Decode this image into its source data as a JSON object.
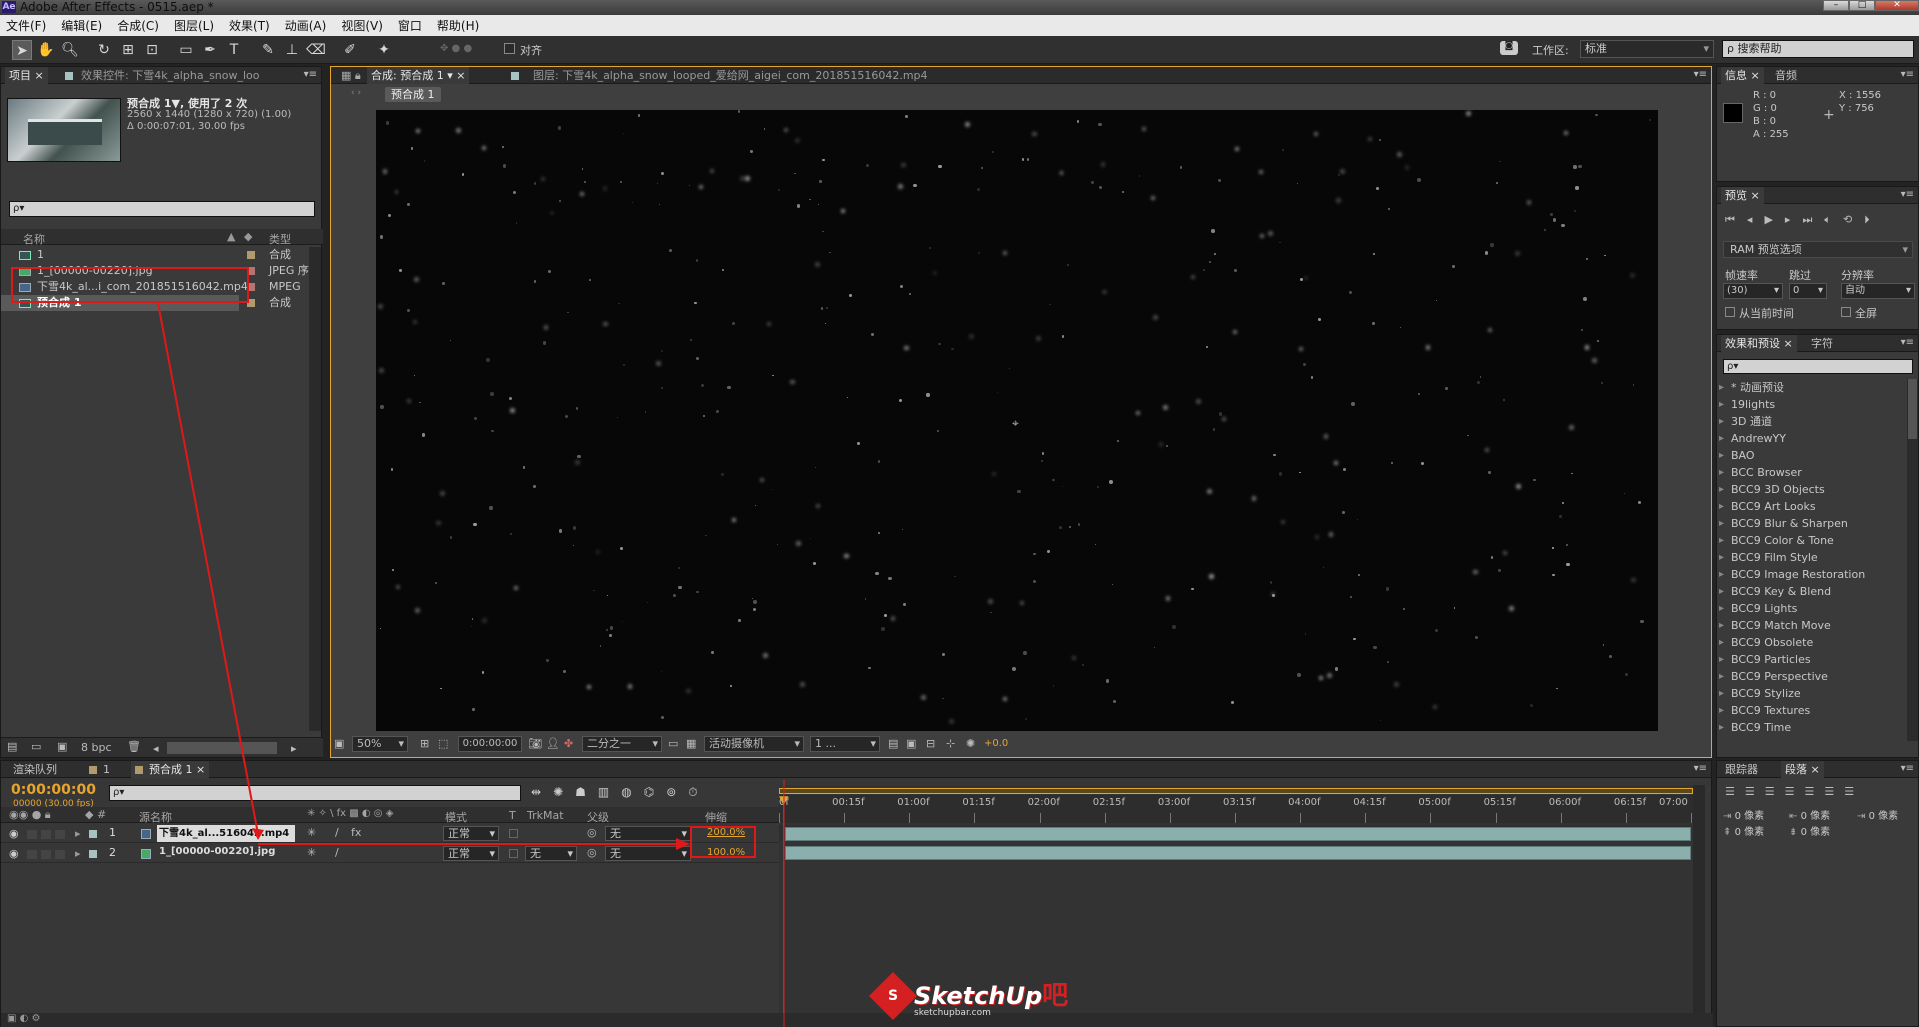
{
  "app": {
    "title": "Adobe After Effects - 0515.aep *",
    "icon_label": "Ae"
  },
  "menu": [
    "文件(F)",
    "编辑(E)",
    "合成(C)",
    "图层(L)",
    "效果(T)",
    "动画(A)",
    "视图(V)",
    "窗口",
    "帮助(H)"
  ],
  "toolbar": {
    "snap_label": "对齐",
    "workspace_label": "工作区:",
    "workspace_value": "标准",
    "search_help_placeholder": "搜索帮助"
  },
  "project_panel": {
    "tab_project": "项目",
    "tab_effect_controls": "效果控件: 下雪4k_alpha_snow_loo",
    "comp_name": "预合成 1▼,  使用了 2 次",
    "comp_size": "2560 x 1440  (1280 x 720) (1.00)",
    "comp_duration": "Δ 0:00:07:01, 30.00 fps",
    "search_placeholder": "ρ▾",
    "col_name": "名称",
    "col_type": "类型",
    "items": [
      {
        "name": "1",
        "type": "合成",
        "kind": "comp",
        "label_color": "#b09a6e"
      },
      {
        "name": "1_[00000-00220].jpg",
        "type": "JPEG 序",
        "kind": "image",
        "label_color": "#b47474"
      },
      {
        "name": "下雪4k_al...i_com_201851516042.mp4",
        "type": "MPEG",
        "kind": "video",
        "label_color": "#b47474"
      },
      {
        "name": "预合成 1",
        "type": "合成",
        "kind": "comp",
        "label_color": "#b09a6e",
        "selected": true
      }
    ],
    "bpc": "8 bpc"
  },
  "comp_viewer": {
    "tab_comp": "合成: 预合成 1",
    "tab_layer": "图层: 下雪4k_alpha_snow_looped_爱给网_aigei_com_201851516042.mp4",
    "breadcrumb": "预合成 1",
    "zoom": "50%",
    "timecode": "0:00:00:00",
    "resolution": "二分之一",
    "camera": "活动摄像机",
    "views": "1 ...",
    "exposure": "+0.0"
  },
  "info_panel": {
    "tab_info": "信息",
    "tab_audio": "音频",
    "r": "R : 0",
    "g": "G : 0",
    "b": "B : 0",
    "a": "A : 255",
    "x": "X : 1556",
    "y": "Y : 756"
  },
  "preview_panel": {
    "tab": "预览",
    "ram_options": "RAM 预览选项",
    "frame_rate_label": "帧速率",
    "skip_label": "跳过",
    "resolution_label": "分辨率",
    "frame_rate_value": "(30)",
    "skip_value": "0",
    "resolution_value": "自动",
    "from_current": "从当前时间",
    "fullscreen": "全屏"
  },
  "effects_panel": {
    "tab_effects": "效果和预设",
    "tab_char": "字符",
    "search_placeholder": "ρ▾",
    "items": [
      "* 动画预设",
      "19lights",
      "3D 通道",
      "AndrewYY",
      "BAO",
      "BCC Browser",
      "BCC9 3D Objects",
      "BCC9 Art Looks",
      "BCC9 Blur & Sharpen",
      "BCC9 Color & Tone",
      "BCC9 Film Style",
      "BCC9 Image Restoration",
      "BCC9 Key & Blend",
      "BCC9 Lights",
      "BCC9 Match Move",
      "BCC9 Obsolete",
      "BCC9 Particles",
      "BCC9 Perspective",
      "BCC9 Stylize",
      "BCC9 Textures",
      "BCC9 Time"
    ]
  },
  "timeline": {
    "tab_render": "渲染队列",
    "tab_comp1": "1",
    "tab_precomp": "预合成 1",
    "timecode": "0:00:00:00",
    "fps": "00000 (30.00 fps)",
    "search_placeholder": "ρ▾",
    "col_source": "源名称",
    "col_mode": "模式",
    "col_t": "T",
    "col_trkmat": "TrkMat",
    "col_parent": "父级",
    "col_scale": "伸缩",
    "ruler": [
      "0f",
      "00:15f",
      "01:00f",
      "01:15f",
      "02:00f",
      "02:15f",
      "03:00f",
      "03:15f",
      "04:00f",
      "04:15f",
      "05:00f",
      "05:15f",
      "06:00f",
      "06:15f",
      "07:00"
    ],
    "layers": [
      {
        "num": "1",
        "name": "下雪4k_al...516042.mp4",
        "mode": "正常",
        "trkmat": "",
        "parent": "无",
        "scale": "200.0%"
      },
      {
        "num": "2",
        "name": "1_[00000-00220].jpg",
        "mode": "正常",
        "trkmat": "无",
        "parent": "无",
        "scale": "100.0%"
      }
    ]
  },
  "tracker_panel": {
    "tab_tracker": "跟踪器",
    "tab_paragraph": "段落",
    "unit": "0 像素"
  },
  "watermark": {
    "text": "SketchUp",
    "suffix": "吧",
    "url": "sketchupbar.com"
  },
  "colors": {
    "accent_timecode": "#e8a52c",
    "annotation_red": "#e01818",
    "layer_bar": "#8aafad"
  }
}
